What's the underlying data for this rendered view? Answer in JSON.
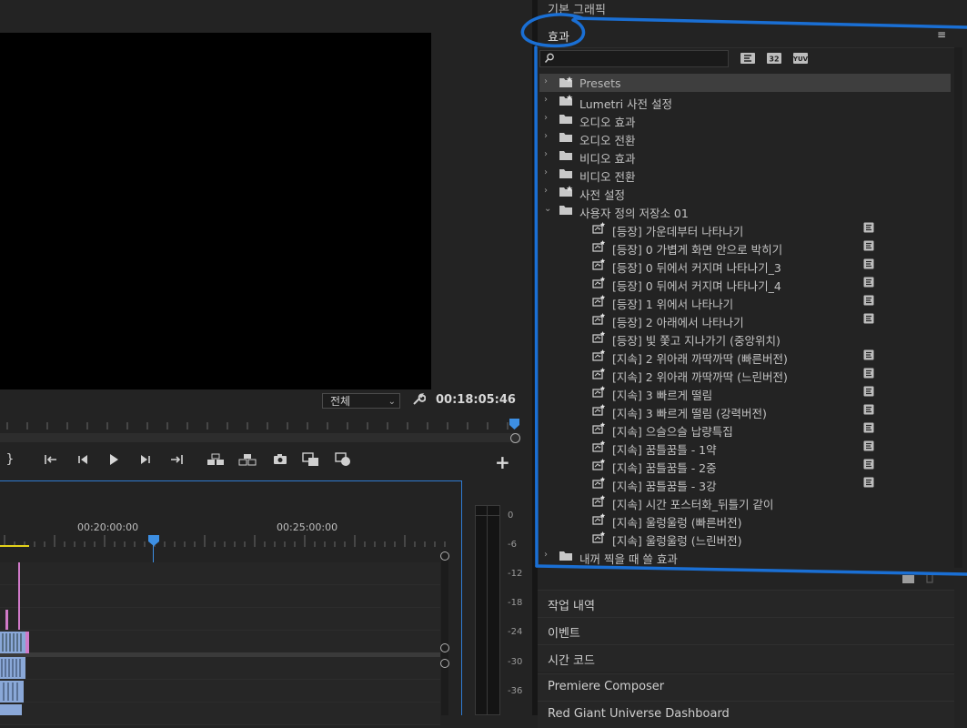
{
  "monitor": {
    "fit_value": "전체",
    "timecode": "00:18:05:46",
    "transport_icons": [
      "mark-out-icon",
      "go-to-in-icon",
      "step-back-icon",
      "play-icon",
      "step-forward-icon",
      "go-to-out-icon",
      "lift-icon",
      "extract-icon",
      "export-frame-icon",
      "insert-icon",
      "overwrite-icon",
      "add-icon"
    ],
    "add_label": "+"
  },
  "timeline": {
    "ruler_labels": [
      "00:20:00:00",
      "00:25:00:00"
    ]
  },
  "meter": {
    "db_labels": [
      "0",
      "-6",
      "-12",
      "-18",
      "-24",
      "-30",
      "-36"
    ]
  },
  "panels": {
    "graphics_tab": "기본 그래픽",
    "effects_title": "효과",
    "menu_icon": "≡",
    "search_icon": "search-icon",
    "filter_icons": [
      "accelerated-effects-icon",
      "32bit-color-icon",
      "yuv-effects-icon"
    ]
  },
  "effects_tree": [
    {
      "label": "Presets",
      "type": "preset-folder",
      "level": 0,
      "expanded": false,
      "selected": true
    },
    {
      "label": "Lumetri 사전 설정",
      "type": "preset-folder",
      "level": 0,
      "expanded": false
    },
    {
      "label": "오디오 효과",
      "type": "folder",
      "level": 0,
      "expanded": false
    },
    {
      "label": "오디오 전환",
      "type": "folder",
      "level": 0,
      "expanded": false
    },
    {
      "label": "비디오 효과",
      "type": "folder",
      "level": 0,
      "expanded": false
    },
    {
      "label": "비디오 전환",
      "type": "folder",
      "level": 0,
      "expanded": false
    },
    {
      "label": "사전 설정",
      "type": "preset-folder",
      "level": 0,
      "expanded": false
    },
    {
      "label": "사용자 정의 저장소 01",
      "type": "folder",
      "level": 0,
      "expanded": true
    },
    {
      "label": "[등장] 가운데부터 나타나기",
      "type": "preset",
      "level": 1,
      "accel": true
    },
    {
      "label": "[등장] 0 가볍게 화면 안으로 박히기",
      "type": "preset",
      "level": 1,
      "accel": true
    },
    {
      "label": "[등장] 0 뒤에서 커지며 나타나기_3",
      "type": "preset",
      "level": 1,
      "accel": true
    },
    {
      "label": "[등장] 0 뒤에서 커지며 나타나기_4",
      "type": "preset",
      "level": 1,
      "accel": true
    },
    {
      "label": "[등장] 1 위에서 나타나기",
      "type": "preset",
      "level": 1,
      "accel": true
    },
    {
      "label": "[등장] 2 아래에서 나타나기",
      "type": "preset",
      "level": 1,
      "accel": true
    },
    {
      "label": "[등장] 빛 쫓고 지나가기 (중앙위치)",
      "type": "preset",
      "level": 1,
      "accel": false
    },
    {
      "label": "[지속] 2 위아래 까딱까딱 (빠른버전)",
      "type": "preset",
      "level": 1,
      "accel": true
    },
    {
      "label": "[지속] 2 위아래 까딱까딱 (느린버전)",
      "type": "preset",
      "level": 1,
      "accel": true
    },
    {
      "label": "[지속] 3 빠르게 떨림",
      "type": "preset",
      "level": 1,
      "accel": true
    },
    {
      "label": "[지속] 3 빠르게 떨림 (강력버전)",
      "type": "preset",
      "level": 1,
      "accel": true
    },
    {
      "label": "[지속] 으슬으슬 납량특집",
      "type": "preset",
      "level": 1,
      "accel": true
    },
    {
      "label": "[지속] 꿈틀꿈틀 - 1약",
      "type": "preset",
      "level": 1,
      "accel": true
    },
    {
      "label": "[지속] 꿈틀꿈틀 - 2중",
      "type": "preset",
      "level": 1,
      "accel": true
    },
    {
      "label": "[지속] 꿈틀꿈틀 - 3강",
      "type": "preset",
      "level": 1,
      "accel": true
    },
    {
      "label": "[지속] 시간 포스터화_뒤틀기 같이",
      "type": "preset",
      "level": 1,
      "accel": false
    },
    {
      "label": "[지속] 울렁울렁 (빠른버전)",
      "type": "preset",
      "level": 1,
      "accel": false
    },
    {
      "label": "[지속] 울렁울렁 (느린버전)",
      "type": "preset",
      "level": 1,
      "accel": false
    },
    {
      "label": "내꺼 찍을 때 쓸 효과",
      "type": "folder",
      "level": 0,
      "expanded": false
    }
  ],
  "collapsed_panels": [
    "작업 내역",
    "이벤트",
    "시간 코드",
    "Premiere Composer",
    "Red Giant Universe Dashboard"
  ],
  "colors": {
    "annotation": "#1a6fd4",
    "accent": "#2f7bd1",
    "playhead": "#3d8fe3"
  }
}
